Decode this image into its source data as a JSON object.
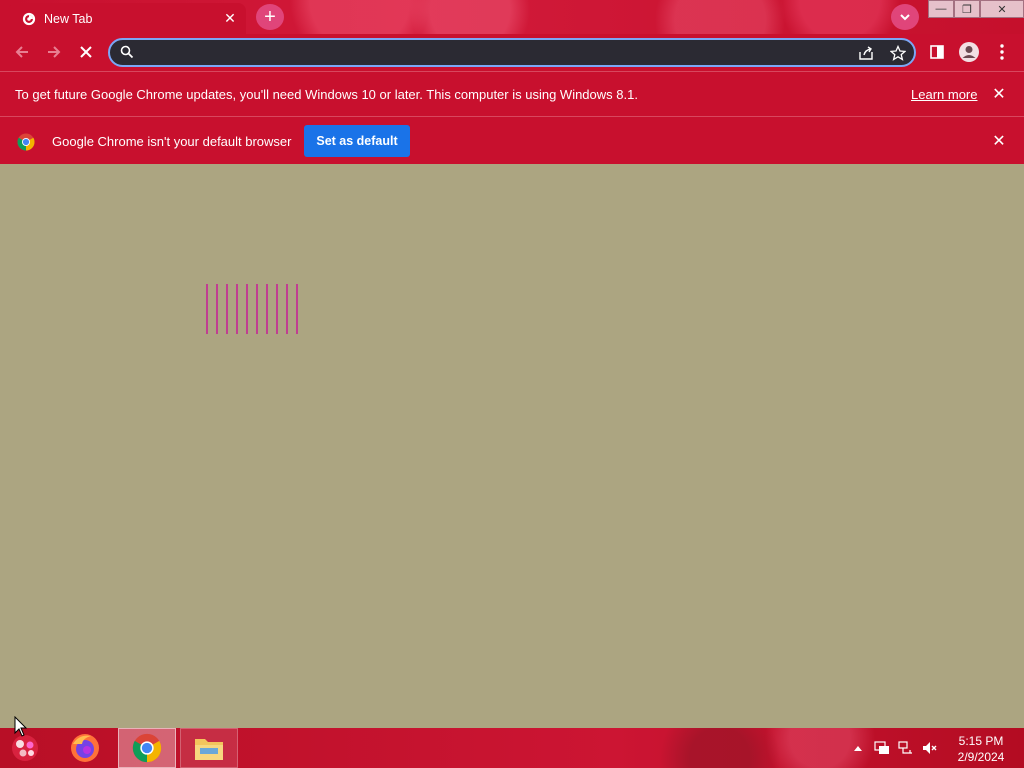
{
  "browser": {
    "tab": {
      "title": "New Tab",
      "close_glyph": "✕"
    },
    "newtab_glyph": "+",
    "window_controls": {
      "minimize": "—",
      "restore": "❐",
      "close": "✕"
    }
  },
  "toolbar": {
    "omnibox_value": "",
    "icons": [
      "back-icon",
      "forward-icon",
      "stop-icon",
      "search-icon",
      "share-icon",
      "bookmark-star-icon",
      "side-panel-icon",
      "profile-icon",
      "more-menu-icon"
    ]
  },
  "infobars": {
    "update": {
      "message": "To get future Google Chrome updates, you'll need Windows 10 or later. This computer is using Windows 8.1.",
      "link": "Learn more",
      "close_glyph": "✕"
    },
    "default_browser": {
      "message": "Google Chrome isn't your default browser",
      "button": "Set as default",
      "close_glyph": "✕"
    }
  },
  "taskbar": {
    "apps": [
      "start-orb",
      "firefox",
      "chrome",
      "file-explorer"
    ],
    "clock": {
      "time": "5:15 PM",
      "date": "2/9/2024"
    }
  },
  "colors": {
    "chrome_frame": "#c8102e",
    "page_background": "#aca581",
    "loader_lines": "#c8129a",
    "primary_button": "#1a73e8"
  }
}
